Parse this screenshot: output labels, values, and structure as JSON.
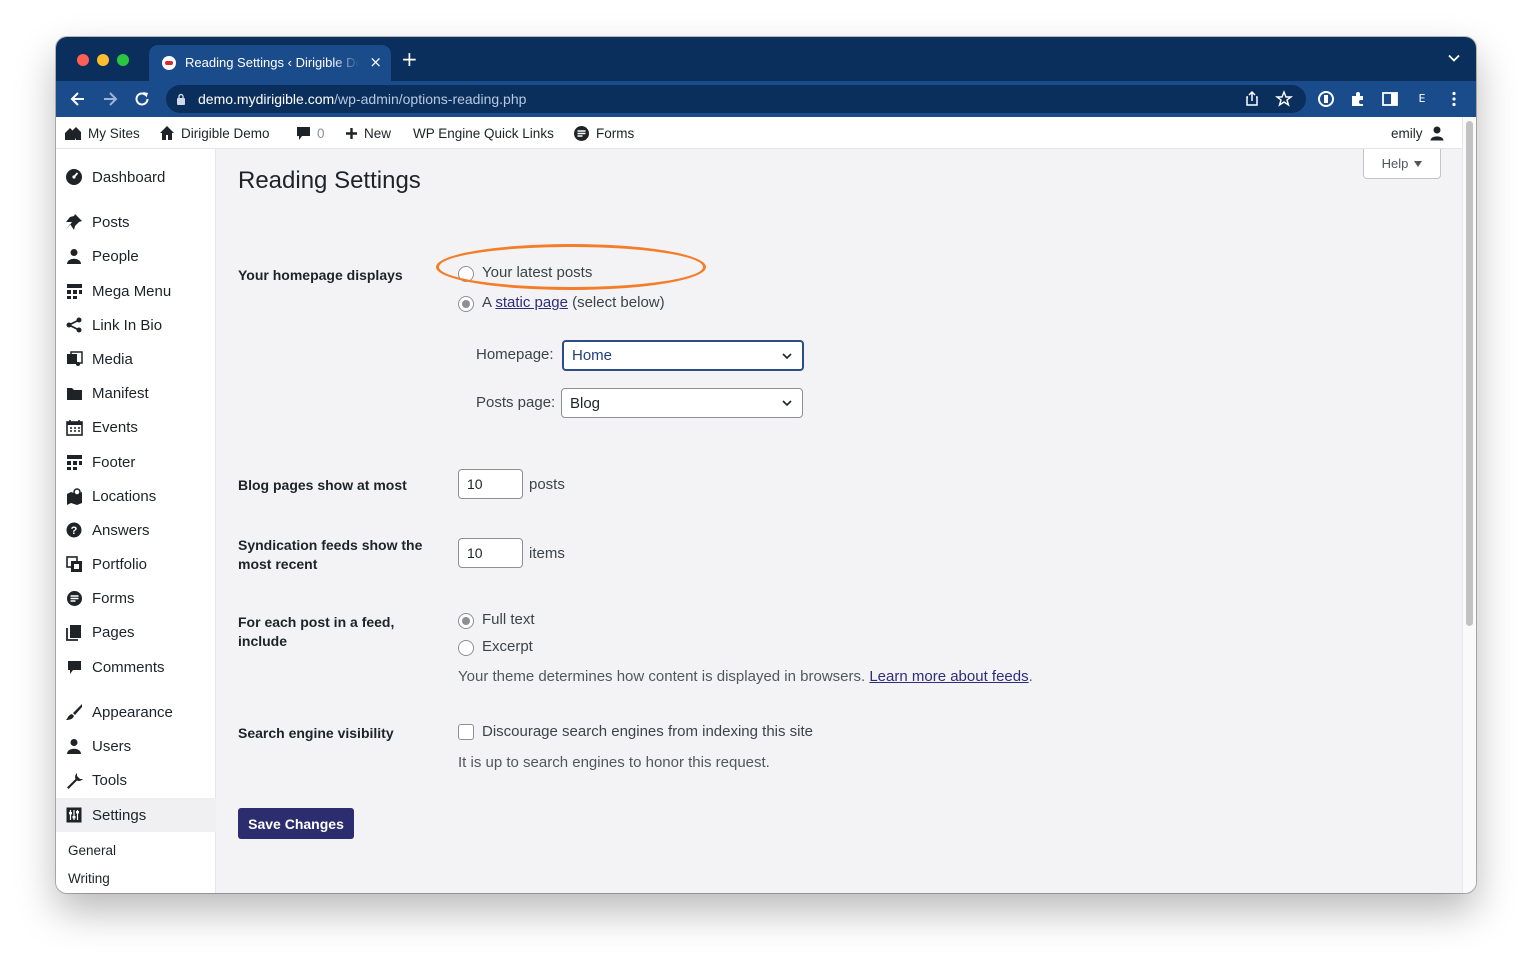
{
  "browser": {
    "tab_title": "Reading Settings ‹ Dirigible Demo",
    "tab_close": "×",
    "new_tab": "+",
    "url_host": "demo.mydirigible.com",
    "url_path": "/wp-admin/options-reading.php",
    "profile_initial": "E"
  },
  "adminbar": {
    "my_sites": "My Sites",
    "site_name": "Dirigible Demo",
    "comments_count": "0",
    "new_label": "New",
    "quick_links": "WP Engine Quick Links",
    "forms": "Forms",
    "user": "emily"
  },
  "sidebar": {
    "items": [
      {
        "label": "Dashboard",
        "icon": "dashboard-icon"
      },
      {
        "label": "Posts",
        "icon": "pin-icon"
      },
      {
        "label": "People",
        "icon": "person-icon"
      },
      {
        "label": "Mega Menu",
        "icon": "grid-icon"
      },
      {
        "label": "Link In Bio",
        "icon": "share-icon"
      },
      {
        "label": "Media",
        "icon": "media-icon"
      },
      {
        "label": "Manifest",
        "icon": "folder-icon"
      },
      {
        "label": "Events",
        "icon": "calendar-icon"
      },
      {
        "label": "Footer",
        "icon": "grid-icon"
      },
      {
        "label": "Locations",
        "icon": "map-icon"
      },
      {
        "label": "Answers",
        "icon": "question-icon"
      },
      {
        "label": "Portfolio",
        "icon": "portfolio-icon"
      },
      {
        "label": "Forms",
        "icon": "forms-icon"
      },
      {
        "label": "Pages",
        "icon": "pages-icon"
      },
      {
        "label": "Comments",
        "icon": "comment-icon"
      },
      {
        "label": "Appearance",
        "icon": "brush-icon"
      },
      {
        "label": "Users",
        "icon": "person-icon"
      },
      {
        "label": "Tools",
        "icon": "wrench-icon"
      },
      {
        "label": "Settings",
        "icon": "settings-icon"
      }
    ],
    "submenu": [
      "General",
      "Writing"
    ]
  },
  "main": {
    "help": "Help",
    "title": "Reading Settings",
    "homepage_displays": {
      "label": "Your homepage displays",
      "option_latest": "Your latest posts",
      "option_static_prefix": "A",
      "option_static_link": "static page",
      "option_static_suffix": "(select below)",
      "selected": "static page"
    },
    "homepage_select": {
      "label": "Homepage:",
      "value": "Home"
    },
    "posts_page_select": {
      "label": "Posts page:",
      "value": "Blog"
    },
    "blog_pages": {
      "label": "Blog pages show at most",
      "value": "10",
      "unit": "posts"
    },
    "syndication": {
      "label": "Syndication feeds show the most recent",
      "value": "10",
      "unit": "items"
    },
    "feed_include": {
      "label": "For each post in a feed, include",
      "option_full": "Full text",
      "option_excerpt": "Excerpt",
      "selected": "Full text",
      "desc": "Your theme determines how content is displayed in browsers.",
      "desc_link": "Learn more about feeds",
      "desc_end": "."
    },
    "search_visibility": {
      "label": "Search engine visibility",
      "checkbox_label": "Discourage search engines from indexing this site",
      "checked": false,
      "desc": "It is up to search engines to honor this request."
    },
    "save_button": "Save Changes"
  },
  "colors": {
    "chrome_dark": "#0b2f5c",
    "chrome_light": "#1a4b8a",
    "primary_button": "#2b2d6e",
    "highlight": "#f47d2a"
  }
}
